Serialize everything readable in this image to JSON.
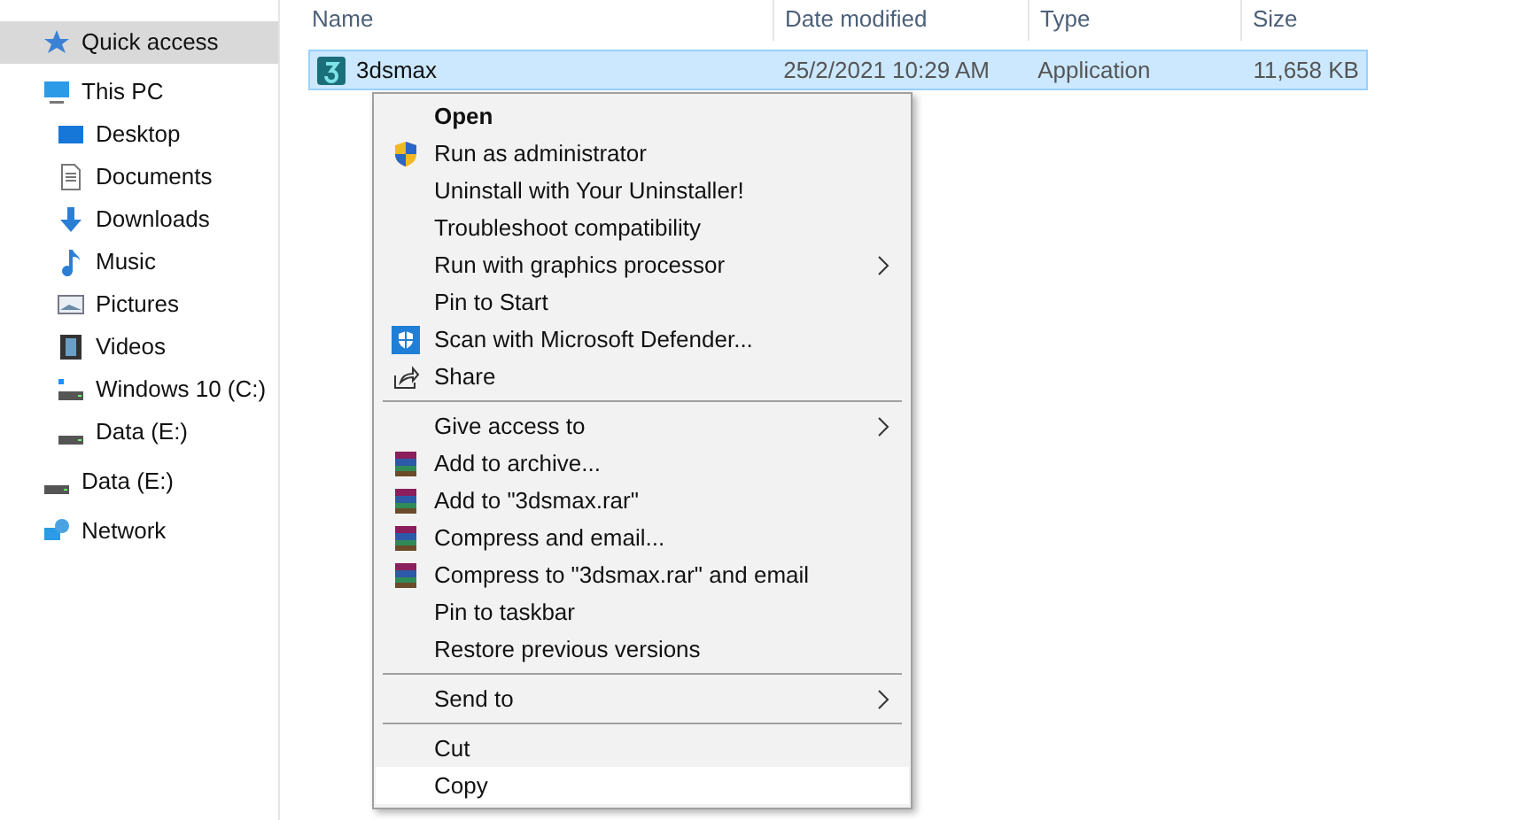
{
  "sidebar": {
    "items": [
      {
        "label": "Quick access",
        "kind": "star",
        "selected": true
      },
      {
        "label": "This PC",
        "kind": "pc",
        "selected": false,
        "children": [
          {
            "label": "Desktop",
            "kind": "desktop",
            "selected": false
          },
          {
            "label": "Documents",
            "kind": "documents",
            "selected": false
          },
          {
            "label": "Downloads",
            "kind": "downloads",
            "selected": false
          },
          {
            "label": "Music",
            "kind": "music",
            "selected": false
          },
          {
            "label": "Pictures",
            "kind": "pictures",
            "selected": false
          },
          {
            "label": "Videos",
            "kind": "videos",
            "selected": false
          },
          {
            "label": "Windows 10 (C:)",
            "kind": "windrive",
            "selected": false
          },
          {
            "label": "Data (E:)",
            "kind": "drive",
            "selected": false
          }
        ]
      },
      {
        "label": "Data (E:)",
        "kind": "drive",
        "selected": false
      },
      {
        "label": "Network",
        "kind": "network",
        "selected": false
      }
    ]
  },
  "table": {
    "columns": [
      "Name",
      "Date modified",
      "Type",
      "Size"
    ],
    "rows": [
      {
        "cells": [
          "3dsmax",
          "25/2/2021 10:29 AM",
          "Application",
          "11,658 KB"
        ],
        "selected": true
      }
    ]
  },
  "context_menu": {
    "items": [
      {
        "kind": "plain",
        "label": "Open",
        "default": true,
        "submenu": false,
        "selected": false
      },
      {
        "kind": "uac",
        "label": "Run as administrator",
        "default": false,
        "submenu": false,
        "selected": false
      },
      {
        "kind": "plain",
        "label": "Uninstall with Your Uninstaller!",
        "default": false,
        "submenu": false,
        "selected": false
      },
      {
        "kind": "plain",
        "label": "Troubleshoot compatibility",
        "default": false,
        "submenu": false,
        "selected": false
      },
      {
        "kind": "plain",
        "label": "Run with graphics processor",
        "default": false,
        "submenu": true,
        "selected": false
      },
      {
        "kind": "plain",
        "label": "Pin to Start",
        "default": false,
        "submenu": false,
        "selected": false
      },
      {
        "kind": "defender",
        "label": "Scan with Microsoft Defender...",
        "default": false,
        "submenu": false,
        "selected": false
      },
      {
        "kind": "share",
        "label": "Share",
        "default": false,
        "submenu": false,
        "selected": false
      },
      {
        "kind": "separator"
      },
      {
        "kind": "plain",
        "label": "Give access to",
        "default": false,
        "submenu": true,
        "selected": false
      },
      {
        "kind": "archive",
        "label": "Add to archive...",
        "default": false,
        "submenu": false,
        "selected": false
      },
      {
        "kind": "archive",
        "label": "Add to \"3dsmax.rar\"",
        "default": false,
        "submenu": false,
        "selected": false
      },
      {
        "kind": "archive",
        "label": "Compress and email...",
        "default": false,
        "submenu": false,
        "selected": false
      },
      {
        "kind": "archive",
        "label": "Compress to \"3dsmax.rar\" and email",
        "default": false,
        "submenu": false,
        "selected": false
      },
      {
        "kind": "plain",
        "label": "Pin to taskbar",
        "default": false,
        "submenu": false,
        "selected": false
      },
      {
        "kind": "plain",
        "label": "Restore previous versions",
        "default": false,
        "submenu": false,
        "selected": false
      },
      {
        "kind": "separator"
      },
      {
        "kind": "plain",
        "label": "Send to",
        "default": false,
        "submenu": true,
        "selected": false
      },
      {
        "kind": "separator"
      },
      {
        "kind": "plain",
        "label": "Cut",
        "default": false,
        "submenu": false,
        "selected": false
      },
      {
        "kind": "plain",
        "label": "Copy",
        "default": false,
        "submenu": false,
        "selected": true
      }
    ]
  }
}
